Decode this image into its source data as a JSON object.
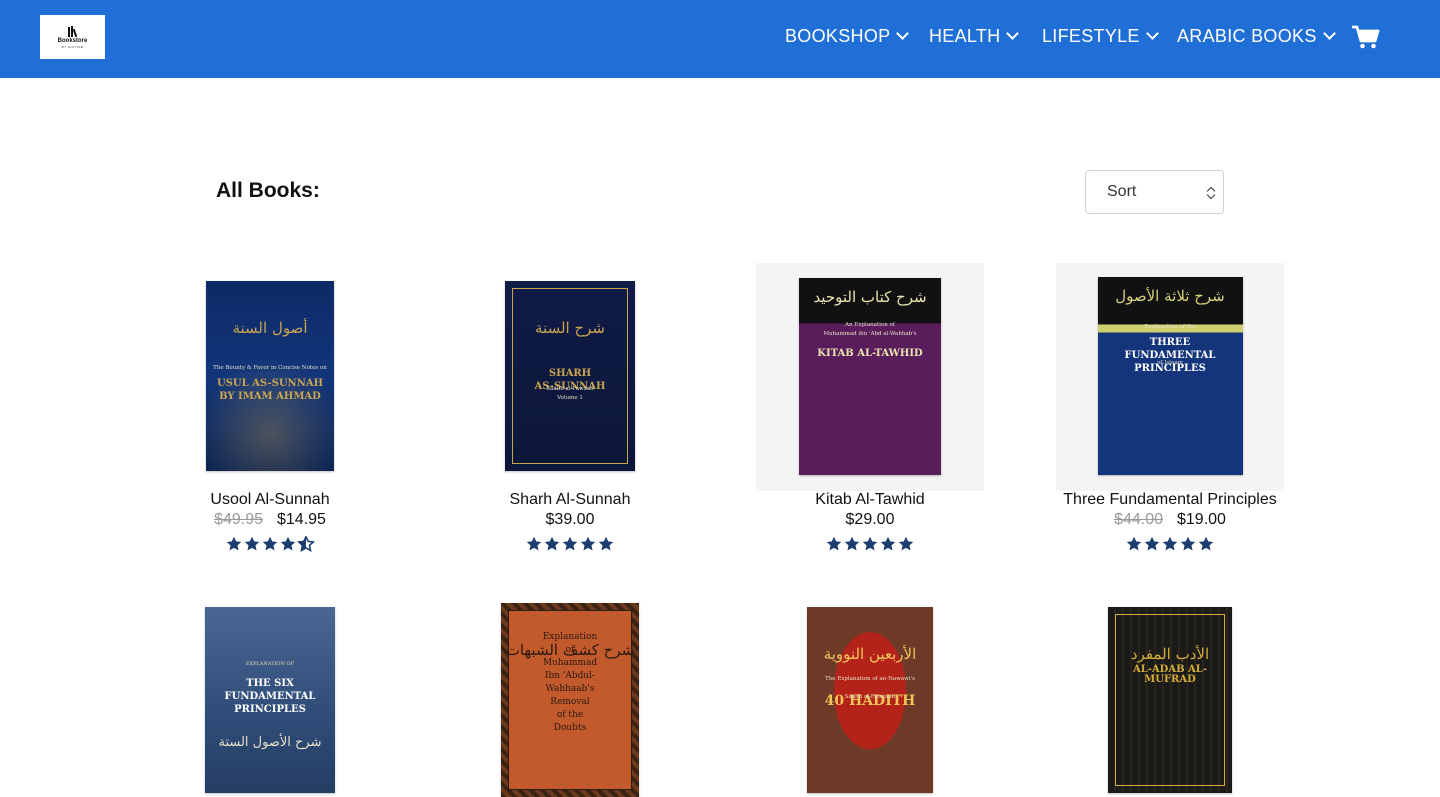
{
  "header": {
    "logo": {
      "text": "Bookstore",
      "sub": "BY ALKITAB"
    },
    "nav": [
      {
        "label": "BOOKSHOP"
      },
      {
        "label": "HEALTH"
      },
      {
        "label": "LIFESTYLE"
      },
      {
        "label": "ARABIC BOOKS"
      }
    ],
    "cart_icon": "cart-icon",
    "colors": {
      "bar": "#1f6fd6",
      "text": "#ffffff"
    }
  },
  "main": {
    "title": "All Books:",
    "sort": {
      "selected": "Sort"
    }
  },
  "rating_color": "#1c3d6e",
  "books": [
    {
      "title": "Usool Al-Sunnah",
      "old_price": "$49.95",
      "price": "$14.95",
      "rating": 4.5,
      "cover": {
        "top": "أصول السنة",
        "lines": [
          "The Bounty & Favor in Concise Notes on",
          "USUL AS-SUNNAH",
          "BY IMAM AHMAD"
        ],
        "colors": {
          "bg": "#12357a",
          "accent": "#c9a552"
        }
      }
    },
    {
      "title": "Sharh Al-Sunnah",
      "old_price": "",
      "price": "$39.00",
      "rating": 5,
      "cover": {
        "top": "شرح السنة",
        "lines": [
          "SHARH",
          "AS-SUNNAH",
          "Saalih al-Fawzan",
          "Volume 1"
        ],
        "colors": {
          "bg": "#101c48",
          "accent": "#c9a552"
        }
      }
    },
    {
      "title": "Kitab Al-Tawhid",
      "old_price": "",
      "price": "$29.00",
      "rating": 5,
      "cover": {
        "top": "شرح كتاب التوحيد",
        "lines": [
          "An Explanation of",
          "Muhammad ibn 'Abd al-Wahhab's",
          "KITAB AL-TAWHID"
        ],
        "colors": {
          "bg": "#5a1d5c",
          "accent": "#e8e3b0"
        }
      }
    },
    {
      "title": "Three Fundamental Principles",
      "old_price": "$44.00",
      "price": "$19.00",
      "rating": 5,
      "cover": {
        "top": "شرح ثلاثة الأصول",
        "lines": [
          "Explanation of the",
          "THREE",
          "FUNDAMENTAL",
          "PRINCIPLES",
          "of Islaam"
        ],
        "colors": {
          "bg": "#14357c",
          "accent": "#d8d27a"
        }
      }
    },
    {
      "title": "",
      "old_price": "",
      "price": "",
      "rating": 0,
      "cover": {
        "top": "EXPLANATION OF",
        "lines": [
          "THE SIX",
          "FUNDAMENTAL",
          "PRINCIPLES",
          "شرح الأصول الستة"
        ],
        "colors": {
          "bg": "#2f4c78",
          "accent": "#e7d9b0"
        }
      }
    },
    {
      "title": "",
      "old_price": "",
      "price": "",
      "rating": 0,
      "cover": {
        "top": "شرح كشف الشبهات",
        "lines": [
          "Explanation",
          "of",
          "Muhammad",
          "Ibn 'Abdul-",
          "Wahhaab's",
          "Removal",
          "of the",
          "Doubts"
        ],
        "colors": {
          "bg": "#c25a2c",
          "accent": "#2c1a10"
        }
      }
    },
    {
      "title": "",
      "old_price": "",
      "price": "",
      "rating": 0,
      "cover": {
        "top": "الأربعين النووية",
        "lines": [
          "The Explanation of an-Nawawi's",
          "40 HADITH",
          "Saalih al-Fawzaan"
        ],
        "colors": {
          "bg": "#b3231a",
          "accent": "#f1c558"
        }
      }
    },
    {
      "title": "",
      "old_price": "",
      "price": "",
      "rating": 0,
      "cover": {
        "top": "الأدب المفرد",
        "lines": [
          "AL-ADAB AL-MUFRAD"
        ],
        "colors": {
          "bg": "#121212",
          "accent": "#d4ad3a"
        }
      }
    }
  ]
}
